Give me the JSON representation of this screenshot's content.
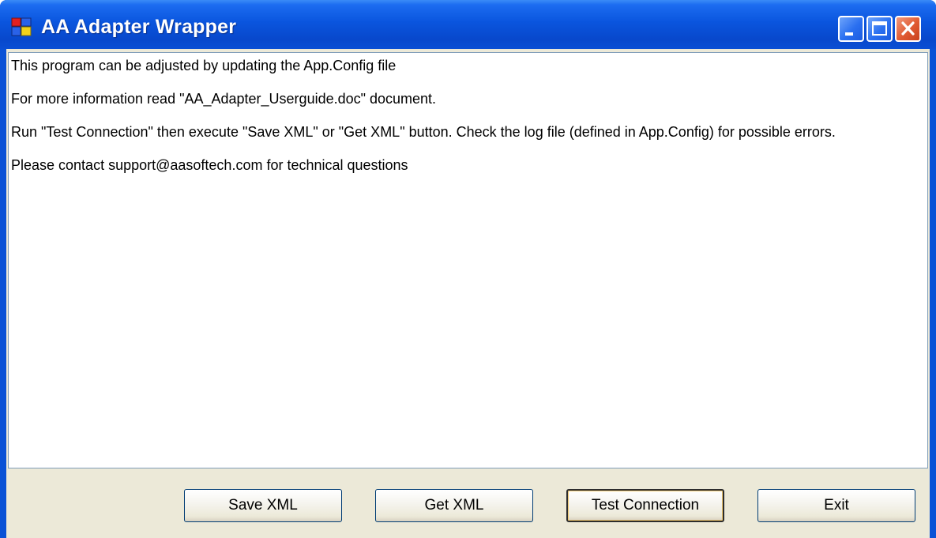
{
  "window": {
    "title": "AA Adapter Wrapper"
  },
  "titlebar_buttons": {
    "minimize_icon": "minimize-icon",
    "maximize_icon": "maximize-icon",
    "close_icon": "close-icon"
  },
  "content": {
    "lines": [
      "This program can be adjusted by updating the App.Config file",
      "For more information read \"AA_Adapter_Userguide.doc\" document.",
      "Run \"Test Connection\" then execute \"Save XML\" or \"Get XML\" button.  Check the log file (defined in App.Config) for possible errors.",
      "Please contact support@aasoftech.com for technical questions"
    ]
  },
  "buttons": {
    "save_xml": "Save XML",
    "get_xml": "Get XML",
    "test_connection": "Test Connection",
    "exit": "Exit"
  },
  "colors": {
    "titlebar": "#0a55de",
    "client_bg": "#ece9d8",
    "close_button": "#e05a32"
  }
}
